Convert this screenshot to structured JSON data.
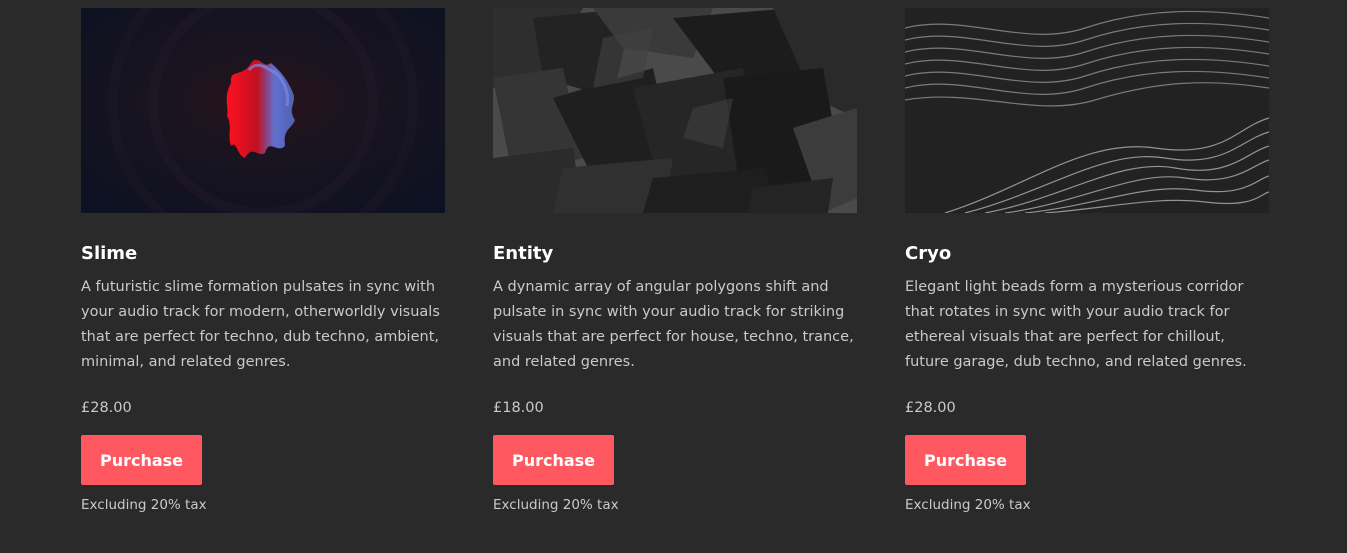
{
  "products": [
    {
      "name": "Slime",
      "description": "A futuristic slime formation pulsates in sync with your audio track for modern, otherworldly visuals that are perfect for techno, dub techno, ambient, minimal, and related genres.",
      "price": "£28.00",
      "button_label": "Purchase",
      "tax_note": "Excluding 20% tax"
    },
    {
      "name": "Entity",
      "description": "A dynamic array of angular polygons shift and pulsate in sync with your audio track for striking visuals that are perfect for house, techno, trance, and related genres.",
      "price": "£18.00",
      "button_label": "Purchase",
      "tax_note": "Excluding 20% tax"
    },
    {
      "name": "Cryo",
      "description": "Elegant light beads form a mysterious corridor that rotates in sync with your audio track for ethereal visuals that are perfect for chillout, future garage, dub techno, and related genres.",
      "price": "£28.00",
      "button_label": "Purchase",
      "tax_note": "Excluding 20% tax"
    }
  ],
  "colors": {
    "background": "#2a2a2a",
    "accent": "#ff5860",
    "title": "#ffffff",
    "body_text": "#c9c9c9"
  }
}
